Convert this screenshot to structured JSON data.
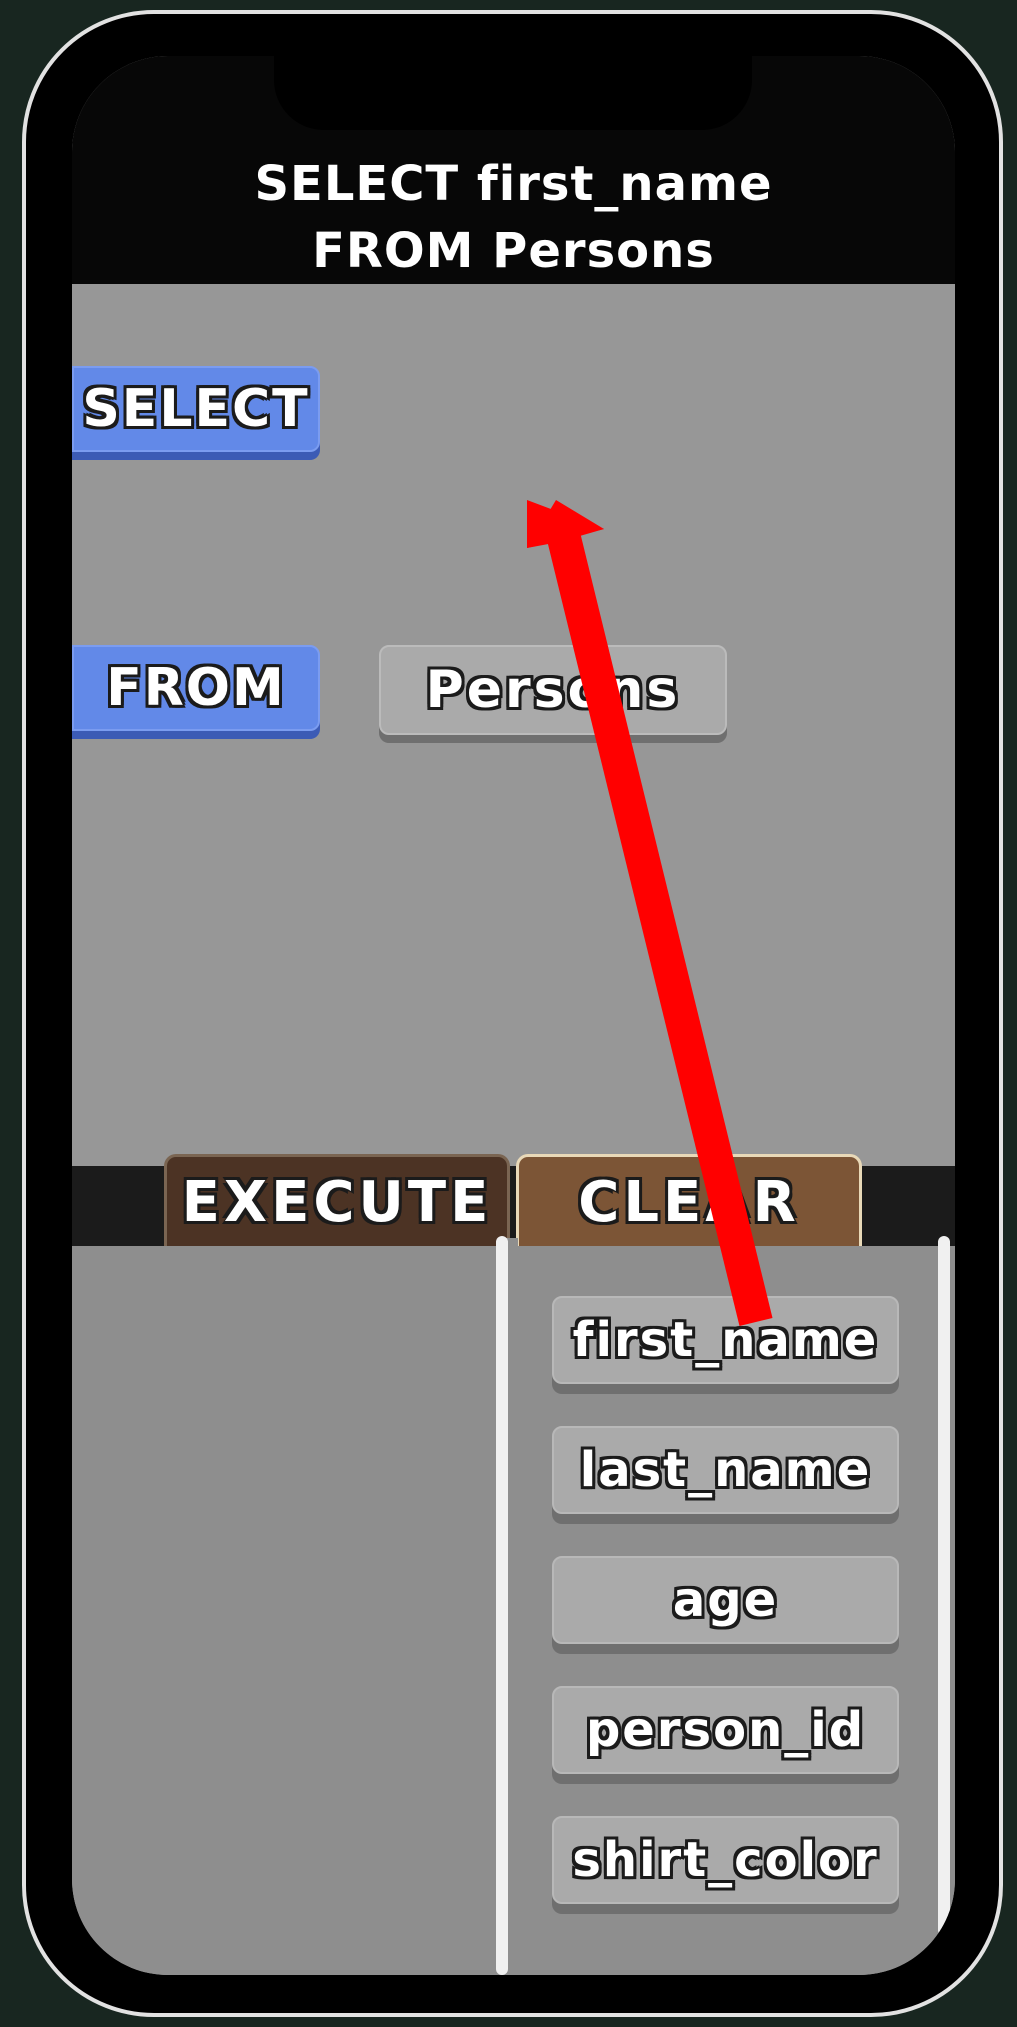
{
  "query": {
    "line1": "SELECT first_name",
    "line2": "FROM Persons"
  },
  "workspace": {
    "select_block": "SELECT",
    "from_block": "FROM",
    "table_block": "Persons"
  },
  "actions": {
    "execute_label": "EXECUTE",
    "clear_label": "CLEAR"
  },
  "columns": [
    "first_name",
    "last_name",
    "age",
    "person_id",
    "shirt_color"
  ],
  "colors": {
    "background": "#182620",
    "keyword_block": "#6289e8",
    "table_block": "#aaaaaa",
    "execute_button": "#4c3324",
    "clear_button": "#7c5536",
    "drag_arrow": "#ff0000"
  },
  "annotation": {
    "type": "drag-arrow",
    "from": "first_name column block",
    "to": "empty slot after SELECT"
  }
}
